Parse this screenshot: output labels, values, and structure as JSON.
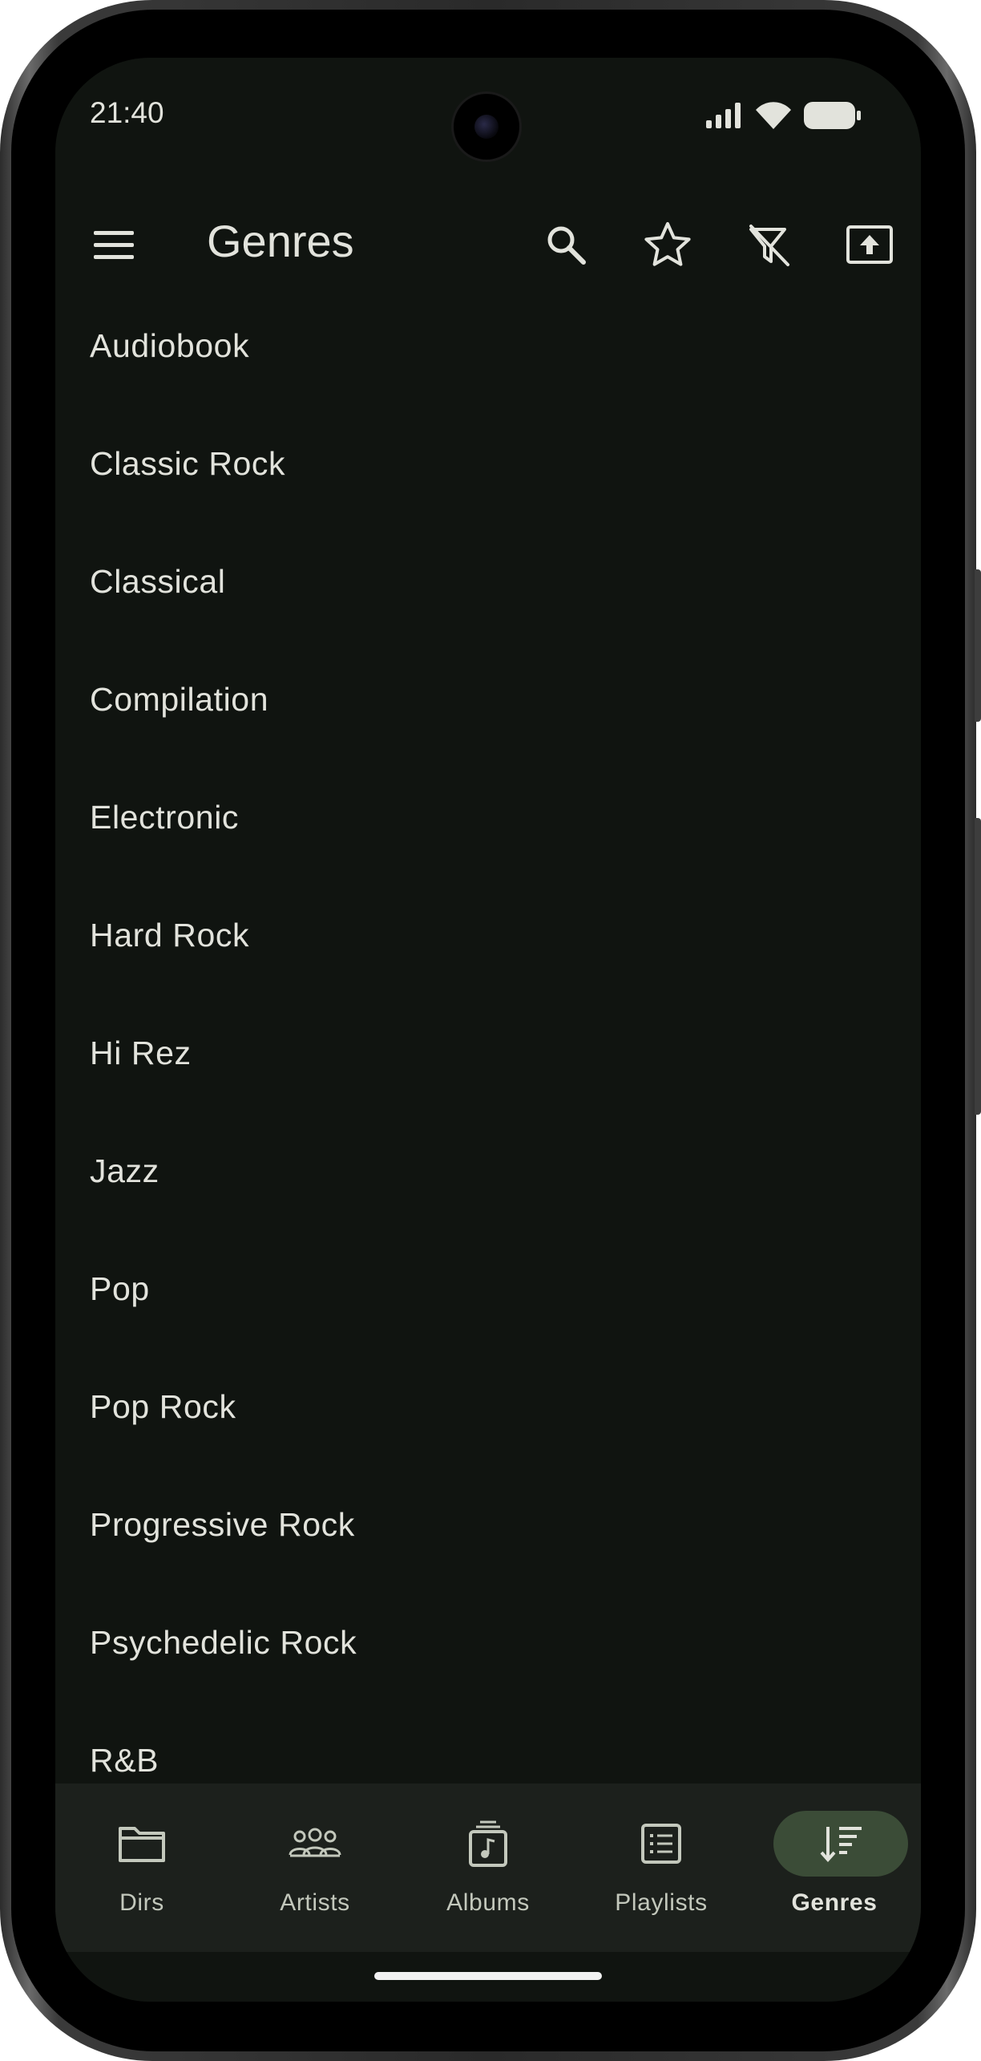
{
  "status_bar": {
    "time": "21:40"
  },
  "app_bar": {
    "title": "Genres",
    "actions": [
      "search-icon",
      "star-icon",
      "filter-off-icon",
      "upload-icon"
    ]
  },
  "genres": [
    "Audiobook",
    "Classic Rock",
    "Classical",
    "Compilation",
    "Electronic",
    "Hard Rock",
    "Hi Rez",
    "Jazz",
    "Pop",
    "Pop Rock",
    "Progressive Rock",
    "Psychedelic Rock",
    "R&B"
  ],
  "bottom_nav": {
    "items": [
      {
        "label": "Dirs",
        "icon": "folder-icon"
      },
      {
        "label": "Artists",
        "icon": "people-icon"
      },
      {
        "label": "Albums",
        "icon": "album-icon"
      },
      {
        "label": "Playlists",
        "icon": "playlist-icon"
      },
      {
        "label": "Genres",
        "icon": "sort-icon"
      }
    ],
    "selected": "Genres"
  },
  "colors": {
    "background": "#101410",
    "nav_background": "#1c201c",
    "active_pill": "#3b4c37",
    "text": "#e2e3dc"
  }
}
